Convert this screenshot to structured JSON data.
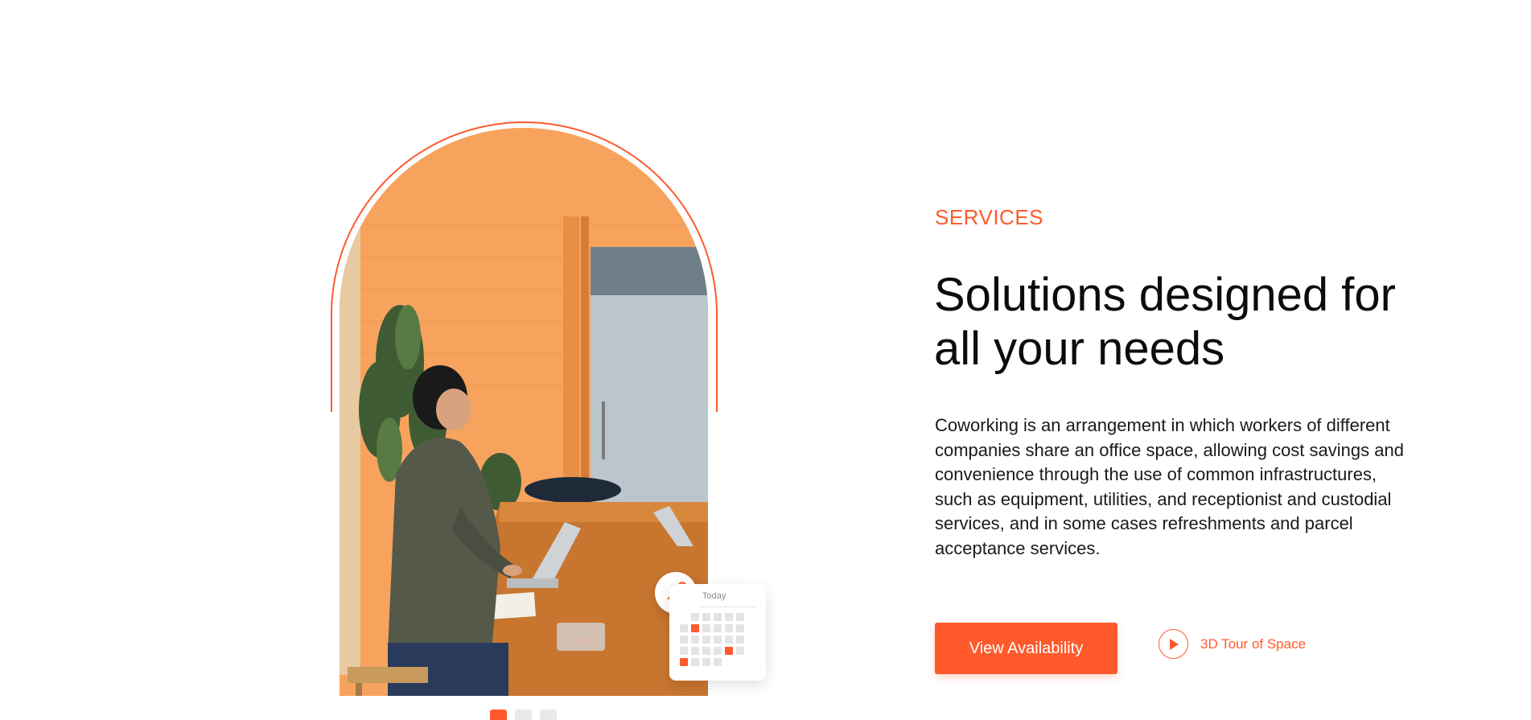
{
  "services": {
    "eyebrow": "SERVICES",
    "headline_line1": "Solutions designed for",
    "headline_line2": "all your needs",
    "description": "Coworking is an arrangement in which workers of different companies share an office space, allowing cost savings and convenience through the use of common infrastructures, such as equipment, utilities, and receptionist and custodial services, and in some cases refreshments and parcel acceptance services.",
    "cta_label": "View Availability",
    "tour_label": "3D Tour of Space"
  },
  "calendar_widget": {
    "today_label": "Today",
    "icons": [
      "bell-plus-icon",
      "calendar-icon"
    ]
  },
  "carousel": {
    "slide_count": 3,
    "active_index": 0
  },
  "colors": {
    "accent": "#ff5a2c",
    "text": "#0c0c0c",
    "background": "#ffffff"
  }
}
